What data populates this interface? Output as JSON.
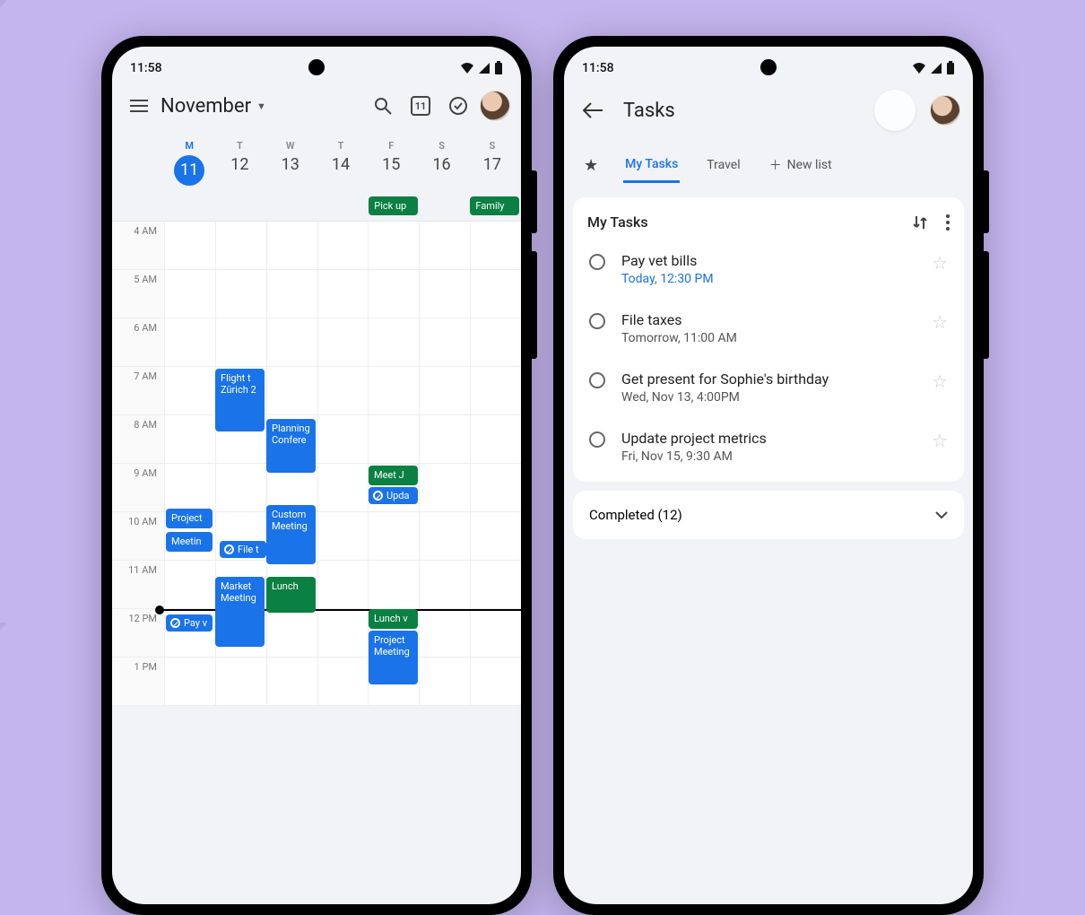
{
  "status": {
    "time": "11:58"
  },
  "calendar": {
    "month_label": "November",
    "today_badge": "11",
    "week": [
      {
        "letter": "M",
        "num": "11",
        "selected": true
      },
      {
        "letter": "T",
        "num": "12"
      },
      {
        "letter": "W",
        "num": "13"
      },
      {
        "letter": "T",
        "num": "14"
      },
      {
        "letter": "F",
        "num": "15"
      },
      {
        "letter": "S",
        "num": "16"
      },
      {
        "letter": "S",
        "num": "17"
      }
    ],
    "allday": {
      "fri": "Pick up",
      "sun": "Family"
    },
    "hours": [
      "4 AM",
      "5 AM",
      "6 AM",
      "7 AM",
      "8 AM",
      "9 AM",
      "10 AM",
      "11 AM",
      "12 PM",
      "1 PM"
    ],
    "events": {
      "flight": {
        "title": "Flight t Zürich 2"
      },
      "planning": {
        "title": "Planning Confere"
      },
      "meetj": {
        "title": "Meet J"
      },
      "update": {
        "title": "Upda"
      },
      "project": {
        "title": "Project"
      },
      "custom": {
        "title": "Custom Meeting"
      },
      "file": {
        "title": "File t"
      },
      "market": {
        "title": "Market Meeting"
      },
      "lunch": {
        "title": "Lunch"
      },
      "meeting1": {
        "title": "Meetin"
      },
      "payv": {
        "title": "Pay v"
      },
      "lunchv": {
        "title": "Lunch v"
      },
      "projmeet": {
        "title": "Project Meeting"
      }
    }
  },
  "tasks": {
    "page_title": "Tasks",
    "tabs": {
      "mytasks": "My Tasks",
      "travel": "Travel",
      "newlist": "New list"
    },
    "list_title": "My Tasks",
    "items": [
      {
        "title": "Pay vet bills",
        "sub": "Today, 12:30 PM",
        "due": true
      },
      {
        "title": "File taxes",
        "sub": "Tomorrow, 11:00 AM"
      },
      {
        "title": "Get present for Sophie's birthday",
        "sub": "Wed, Nov 13, 4:00PM"
      },
      {
        "title": "Update project metrics",
        "sub": "Fri, Nov 15, 9:30 AM"
      }
    ],
    "completed_label": "Completed (12)"
  }
}
